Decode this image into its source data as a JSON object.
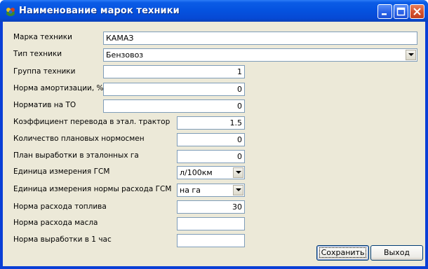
{
  "window": {
    "title": "Наименование марок техники",
    "controls": {
      "minimize": "minimize",
      "maximize": "maximize",
      "close": "close"
    }
  },
  "form": {
    "marka": {
      "label": "Марка техники",
      "value": "КАМАЗ"
    },
    "tip": {
      "label": "Тип техники",
      "value": "Бензовоз"
    },
    "gruppa": {
      "label": "Группа техники",
      "value": "1"
    },
    "amort": {
      "label": "Норма амортизации, %",
      "value": "0"
    },
    "normativ_to": {
      "label": "Норматив на ТО",
      "value": "0"
    },
    "koef": {
      "label": "Коэффициент перевода в этал. трактор",
      "value": "1.5"
    },
    "kol_norm": {
      "label": "Количество плановых нормосмен",
      "value": "0"
    },
    "plan_vyr": {
      "label": "План выработки в эталонных га",
      "value": "0"
    },
    "ed_gsm": {
      "label": "Единица измерения ГСМ",
      "value": "л/100км"
    },
    "ed_norm_gsm": {
      "label": "Единица измерения нормы расхода ГСМ",
      "value": "на га"
    },
    "norma_topl": {
      "label": "Норма расхода топлива",
      "value": "30"
    },
    "norma_masla": {
      "label": "Норма расхода масла",
      "value": ""
    },
    "norma_vyr": {
      "label": "Норма выработки в 1 час",
      "value": ""
    }
  },
  "buttons": {
    "save": "Сохранить",
    "exit": "Выход"
  }
}
